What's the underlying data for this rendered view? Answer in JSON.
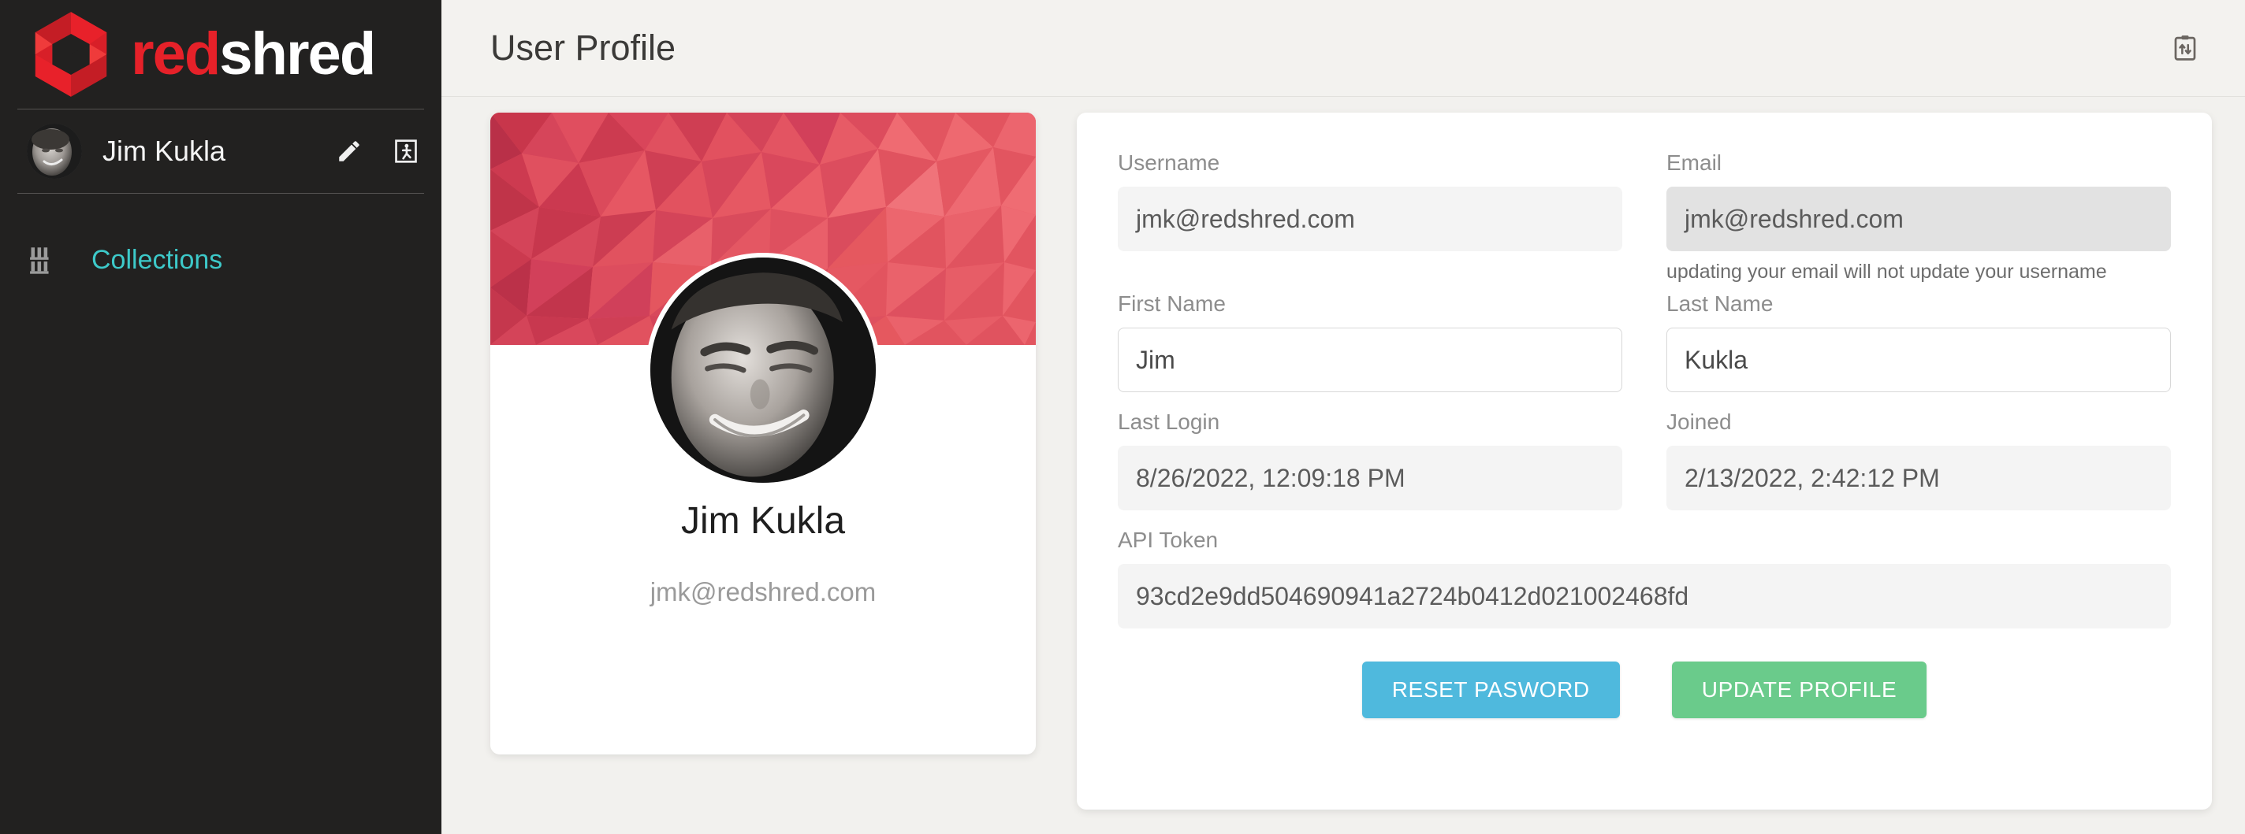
{
  "brand": {
    "name_red": "red",
    "name_white": "shred",
    "logo_icon": "redshred-cube-logo",
    "red_hex": "#e62129"
  },
  "sidebar": {
    "user": {
      "name": "Jim Kukla",
      "avatar_icon": "user-avatar-photo",
      "edit_icon": "pencil-icon",
      "logout_icon": "exit-door-icon"
    },
    "nav_items": [
      {
        "label": "Collections",
        "icon": "library-shelf-icon",
        "active": true
      }
    ],
    "background_hex": "#222120",
    "accent_hex": "#3dc9c9"
  },
  "header": {
    "title": "User Profile",
    "action_icon": "clipboard-transfer-icon"
  },
  "profile_card": {
    "banner_icon": "low-poly-red-pattern",
    "avatar_icon": "user-avatar-photo",
    "name": "Jim Kukla",
    "email": "jmk@redshred.com"
  },
  "form": {
    "fields": {
      "username": {
        "label": "Username",
        "value": "jmk@redshred.com",
        "placeholder": "Username",
        "state": "readonly"
      },
      "email": {
        "label": "Email",
        "value": "jmk@redshred.com",
        "placeholder": "Email",
        "state": "readonly-hover",
        "help": "updating your email will not update your username"
      },
      "first_name": {
        "label": "First Name",
        "value": "Jim",
        "placeholder": "First Name",
        "state": "editable"
      },
      "last_name": {
        "label": "Last Name",
        "value": "Kukla",
        "placeholder": "Last Name",
        "state": "editable"
      },
      "last_login": {
        "label": "Last Login",
        "value": "8/26/2022, 12:09:18 PM",
        "placeholder": "Last Login",
        "state": "readonly"
      },
      "joined": {
        "label": "Joined",
        "value": "2/13/2022, 2:42:12 PM",
        "placeholder": "Joined",
        "state": "readonly"
      },
      "api_token": {
        "label": "API Token",
        "value": "93cd2e9dd504690941a2724b0412d021002468fd",
        "placeholder": "API Token",
        "state": "readonly"
      }
    },
    "buttons": {
      "reset_password": {
        "label": "RESET PASWORD",
        "color_hex": "#4fb9dd"
      },
      "update_profile": {
        "label": "UPDATE PROFILE",
        "color_hex": "#6acb8b"
      }
    }
  }
}
